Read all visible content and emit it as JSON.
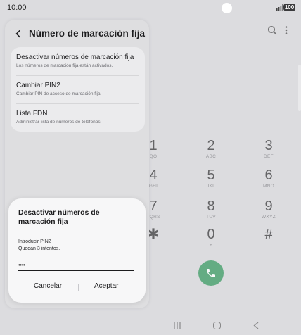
{
  "status_bar": {
    "time": "10:00",
    "battery": "100"
  },
  "settings": {
    "title": "Número de marcación fija",
    "rows": [
      {
        "title": "Desactivar números de marcación fija",
        "subtitle": "Los números de marcación fija están activados."
      },
      {
        "title": "Cambiar PIN2",
        "subtitle": "Cambiar PIN de acceso de marcación fija"
      },
      {
        "title": "Lista FDN",
        "subtitle": "Administrar lista de números de teléfonos"
      }
    ]
  },
  "dialer": {
    "keys": [
      {
        "digit": "1",
        "letters": "QO"
      },
      {
        "digit": "2",
        "letters": "ABC"
      },
      {
        "digit": "3",
        "letters": "DEF"
      },
      {
        "digit": "4",
        "letters": "GHI"
      },
      {
        "digit": "5",
        "letters": "JKL"
      },
      {
        "digit": "6",
        "letters": "MNO"
      },
      {
        "digit": "7",
        "letters": "PQRS"
      },
      {
        "digit": "8",
        "letters": "TUV"
      },
      {
        "digit": "9",
        "letters": "WXYZ"
      },
      {
        "digit": "✱",
        "letters": ""
      },
      {
        "digit": "0",
        "letters": "+"
      },
      {
        "digit": "#",
        "letters": ""
      }
    ],
    "call_color": "#1d8a4a"
  },
  "dialog": {
    "title": "Desactivar números de marcación fija",
    "prompt": "Introducir PIN2",
    "attempts": "Quedan 3 intentos.",
    "pin_value": "••••",
    "cancel_label": "Cancelar",
    "accept_label": "Aceptar"
  }
}
